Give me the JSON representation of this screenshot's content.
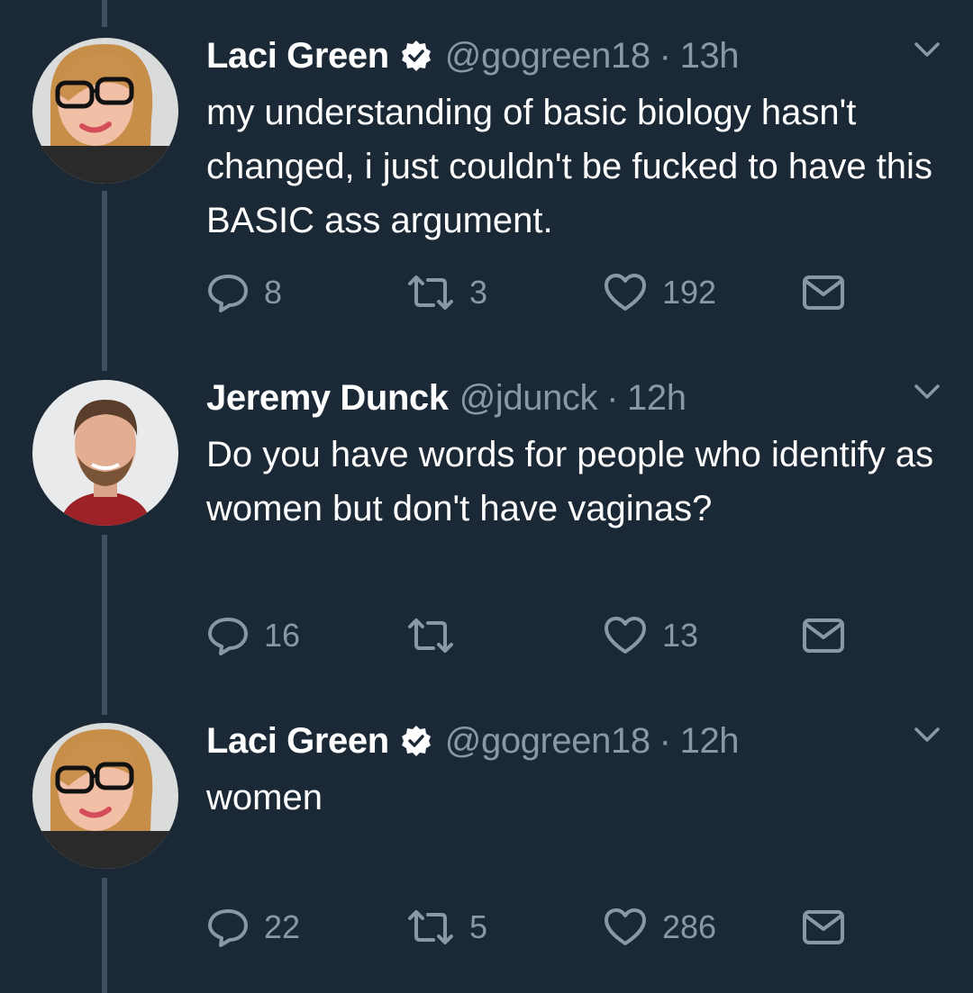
{
  "tweets": [
    {
      "name": "Laci Green",
      "verified": true,
      "handle": "@gogreen18",
      "separator": "·",
      "time": "13h",
      "text": "my understanding of basic biology hasn't changed,  i just couldn't be fucked to have this BASIC ass argument.",
      "replies": "8",
      "retweets": "3",
      "likes": "192"
    },
    {
      "name": "Jeremy Dunck",
      "verified": false,
      "handle": "@jdunck",
      "separator": "·",
      "time": "12h",
      "text": "Do you have words for people who identify as women but don't have vaginas?",
      "replies": "16",
      "retweets": "",
      "likes": "13"
    },
    {
      "name": "Laci Green",
      "verified": true,
      "handle": "@gogreen18",
      "separator": "·",
      "time": "12h",
      "text": "women",
      "replies": "22",
      "retweets": "5",
      "likes": "286"
    }
  ],
  "colors": {
    "background": "#1b2836",
    "text": "#ffffff",
    "muted": "#8899a6",
    "thread_line": "#3f4f61"
  },
  "icons": [
    "reply-icon",
    "retweet-icon",
    "like-icon",
    "message-icon",
    "verified-icon",
    "caret-down-icon"
  ]
}
